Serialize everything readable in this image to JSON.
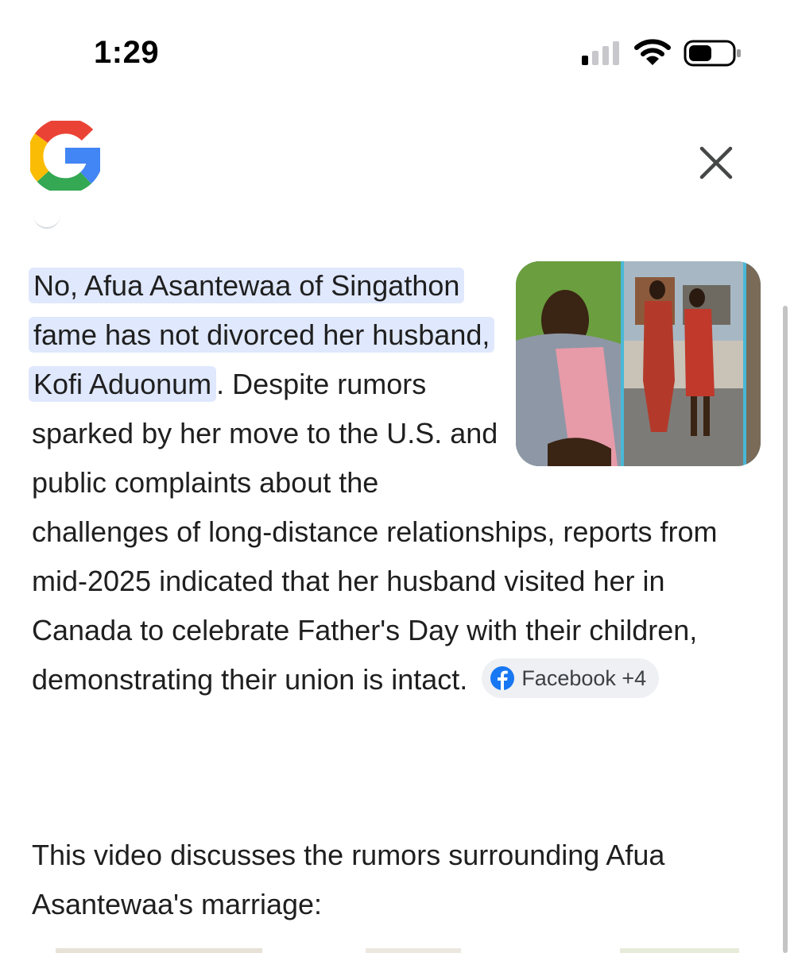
{
  "status_bar": {
    "time": "1:29"
  },
  "header": {
    "logo_icon": "google-g-logo",
    "close_icon": "close-icon"
  },
  "answer": {
    "highlighted": "No, Afua Asantewaa of Singathon fame has not divorced her husband, Kofi Aduonum",
    "body": ". Despite rumors sparked by her move to the U.S. and public complaints about the challenges of long-distance relationships, reports from mid-2025 indicated that her husband visited her in Canada to celebrate Father's Day with their children, demonstrating their union is intact.",
    "source_chip": {
      "icon": "facebook-icon",
      "label": "Facebook +4"
    }
  },
  "video_intro": "This video discusses the rumors surrounding Afua Asantewaa's marriage:",
  "colors": {
    "highlight": "#dfe8fc",
    "chip_bg": "#eef0f4",
    "facebook_blue": "#1877f2"
  }
}
